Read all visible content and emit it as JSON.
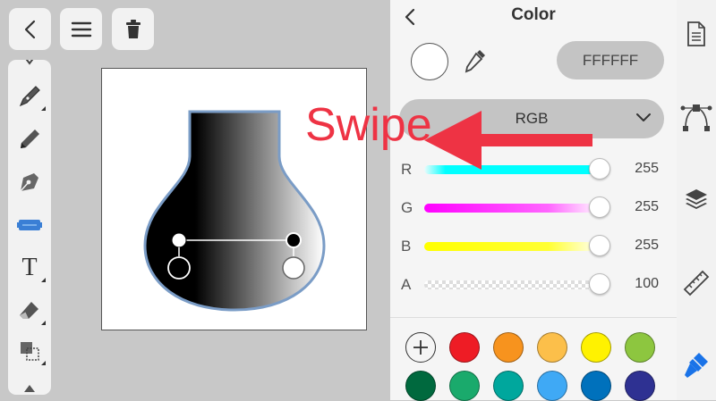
{
  "toolbar": {
    "back_icon": "chevron-left-icon",
    "menu_icon": "hamburger-menu-icon",
    "delete_icon": "trash-icon"
  },
  "tools": [
    {
      "name": "pen-tool",
      "icon": "pen-nib-icon"
    },
    {
      "name": "pencil-tool",
      "icon": "pencil-icon"
    },
    {
      "name": "node-edit-tool",
      "icon": "node-edit-icon"
    },
    {
      "name": "gradient-tool",
      "icon": "gradient-icon"
    },
    {
      "name": "text-tool",
      "icon": "text-icon",
      "glyph": "T"
    },
    {
      "name": "eraser-tool",
      "icon": "eraser-icon"
    },
    {
      "name": "transform-tool",
      "icon": "transform-icon"
    }
  ],
  "panel": {
    "title": "Color",
    "hex_value": "FFFFFF",
    "swatch_color": "#ffffff",
    "mode": "RGB",
    "sliders": [
      {
        "label": "R",
        "value": "255",
        "from": "#eafcfc",
        "to": "#00ffff"
      },
      {
        "label": "G",
        "value": "255",
        "from": "#ff00ff",
        "to": "#ffffff"
      },
      {
        "label": "B",
        "value": "255",
        "from": "#ffff00",
        "to": "#ffffff"
      },
      {
        "label": "A",
        "value": "100",
        "from": "checker",
        "to": "#ffffff"
      }
    ],
    "palette": [
      "#ee1c25",
      "#f7931e",
      "#fcbf4a",
      "#fff200",
      "#8dc63f",
      "#00693e",
      "#1aaa6c",
      "#00a79d",
      "#3fa9f5",
      "#0071bc",
      "#2e3192"
    ]
  },
  "rightbar": [
    "document-icon",
    "bezier-curve-icon",
    "layers-icon",
    "ruler-icon",
    "paintbrush-icon"
  ],
  "overlay": {
    "swipe_text": "Swipe",
    "swipe_color": "#ee3344"
  }
}
